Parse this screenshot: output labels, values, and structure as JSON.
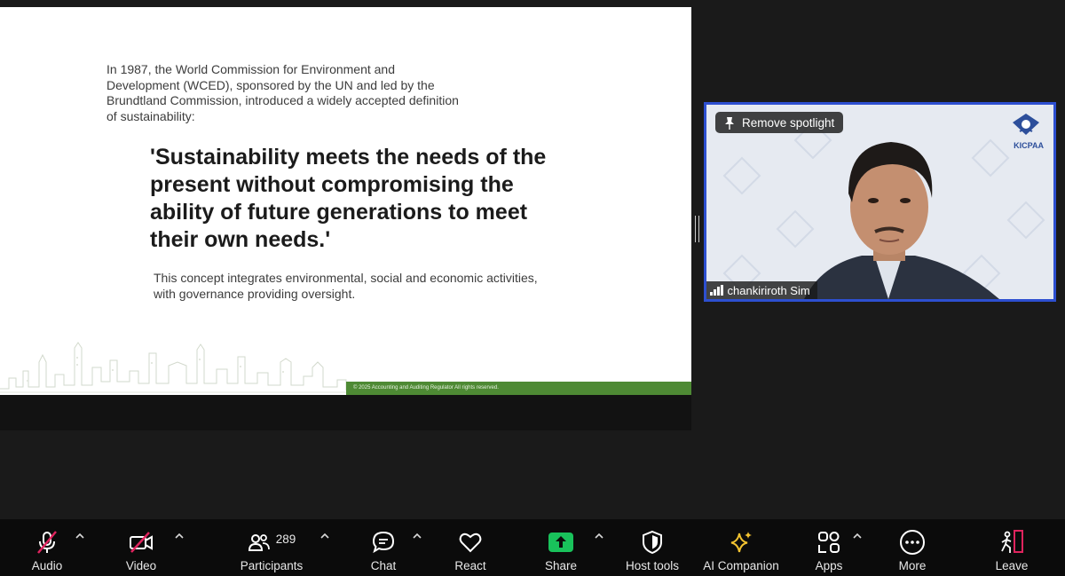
{
  "slide": {
    "intro_text": "In 1987, the World Commission for Environment and Development (WCED), sponsored by the UN and led by the Brundtland Commission, introduced a widely accepted definition of sustainability:",
    "quote": "'Sustainability meets the needs of the present without compromising the ability of future generations to meet their own needs.'",
    "concept_text": "This concept integrates environmental, social and economic activities, with governance providing oversight.",
    "footer": "© 2025 Accounting and Auditing Regulator All rights reserved.",
    "accent_green": "#4e8a34"
  },
  "video": {
    "spotlight_label": "Remove spotlight",
    "participant_name": "chankiriroth Sim",
    "logo_text": "KICPAA",
    "border_color": "#2d4fd0"
  },
  "toolbar": {
    "audio": "Audio",
    "video": "Video",
    "participants": "Participants",
    "participant_count": "289",
    "chat": "Chat",
    "react": "React",
    "share": "Share",
    "host_tools": "Host tools",
    "ai_companion": "AI Companion",
    "apps": "Apps",
    "more": "More",
    "leave": "Leave",
    "share_color": "#19c25b",
    "muted_color": "#e0245e"
  }
}
